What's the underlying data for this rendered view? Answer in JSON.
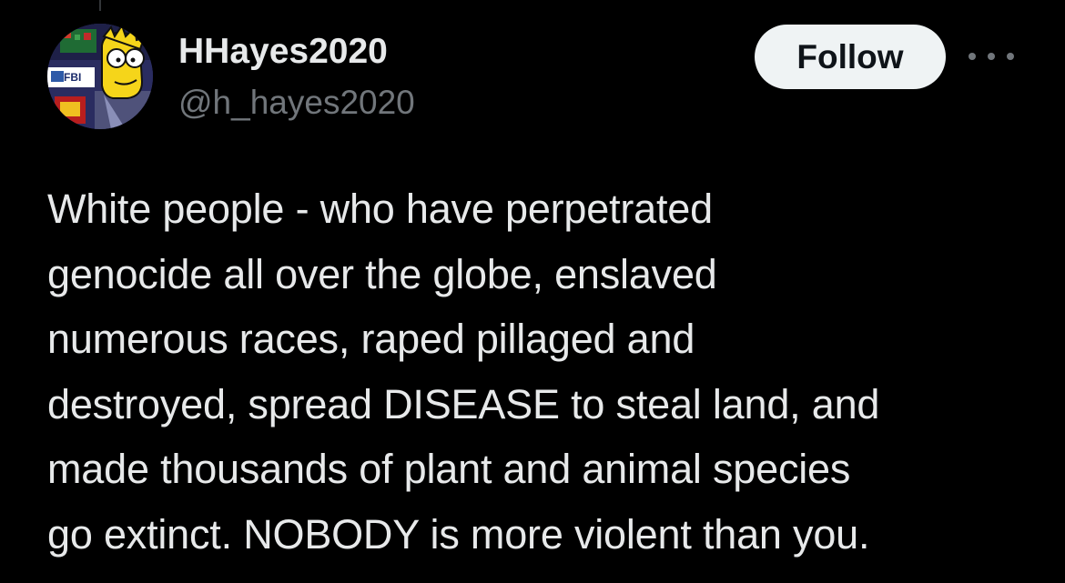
{
  "author": {
    "display_name": "HHayes2020",
    "handle": "@h_hayes2020",
    "avatar_icon": "cartoon-avatar-icon"
  },
  "actions": {
    "follow_label": "Follow",
    "more_icon": "more-options-icon"
  },
  "tweet": {
    "text": "White people - who have perpetrated\ngenocide all over the globe, enslaved\nnumerous races, raped pillaged and\ndestroyed, spread DISEASE to steal land, and\nmade thousands of plant and animal species\ngo extinct. NOBODY is more violent than you."
  },
  "theme": {
    "background": "#000000",
    "text_primary": "#e7e9ea",
    "text_secondary": "#71767b",
    "button_bg": "#eff3f4",
    "button_text": "#0f1419"
  }
}
